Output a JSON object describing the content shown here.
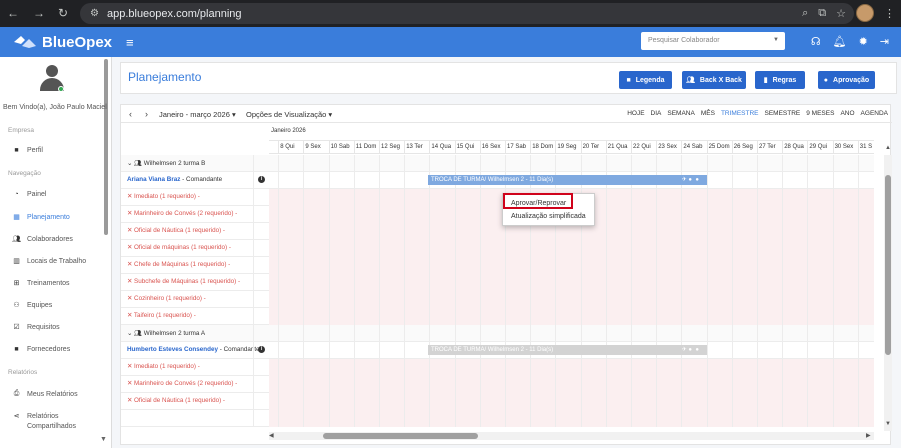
{
  "browser": {
    "url": "app.blueopex.com/planning"
  },
  "topbar": {
    "brand": "BlueOpex",
    "search_placeholder": "Pesquisar Colaborador"
  },
  "sidebar": {
    "welcome": "Bem Vindo(a), João Paulo Maciel",
    "sections": {
      "empresa": "Empresa",
      "navegacao": "Navegação",
      "relatorios": "Relatórios"
    },
    "items": {
      "perfil": "Perfil",
      "painel": "Painel",
      "planejamento": "Planejamento",
      "colaboradores": "Colaboradores",
      "locais": "Locais de Trabalho",
      "treinamentos": "Treinamentos",
      "equipes": "Equipes",
      "requisitos": "Requisitos",
      "fornecedores": "Fornecedores",
      "meus_relatorios": "Meus Relatórios",
      "relatorios_comp": "Relatórios",
      "relatorios_comp2": "Compartilhados"
    }
  },
  "page": {
    "title": "Planejamento",
    "buttons": {
      "legenda": "Legenda",
      "backxback": "Back X Back",
      "regras": "Regras",
      "aprovacao": "Aprovação"
    }
  },
  "calendar": {
    "range": "Janeiro - março 2026",
    "view_options": "Opções de Visualização",
    "views": [
      "HOJE",
      "DIA",
      "SEMANA",
      "MÊS",
      "TRIMESTRE",
      "SEMESTRE",
      "9 MESES",
      "ANO",
      "AGENDA"
    ],
    "active_view": "TRIMESTRE",
    "month": "Janeiro 2026",
    "days": [
      "e",
      "8 Qui",
      "9 Sex",
      "10 Sab",
      "11 Dom",
      "12 Seg",
      "13 Ter",
      "14 Qua",
      "15 Qui",
      "16 Sex",
      "17 Sab",
      "18 Dom",
      "19 Seg",
      "20 Ter",
      "21 Qua",
      "22 Qui",
      "23 Sex",
      "24 Sab",
      "25 Dom",
      "26 Seg",
      "27 Ter",
      "28 Qua",
      "29 Qui",
      "30 Sex",
      "31 S"
    ]
  },
  "rows": {
    "g1": "Wilhelmsen 2 turma B",
    "p1_name": "Ariana Viana Braz",
    "p1_role": " - Comandante",
    "r1": "✕ Imediato (1 requerido) -",
    "r2": "✕ Marinheiro de Convés (2 requerido) -",
    "r3": "✕ Oficial de Náutica (1 requerido) -",
    "r4": "✕ Oficial de máquinas (1 requerido) -",
    "r5": "✕ Chefe de Máquinas (1 requerido) -",
    "r6": "✕ Subchefe de Máquinas (1 requerido) -",
    "r7": "✕ Cozinheiro (1 requerido) -",
    "r8": "✕ Taifeiro (1 requerido) -",
    "g2": "Wilhelmsen 2 turma A",
    "p2_name": "Humberto Esteves Consendey",
    "p2_role": " - Comandante",
    "r9": "✕ Imediato (1 requerido) -",
    "r10": "✕ Marinheiro de Convés (2 requerido) -",
    "r11": "✕ Oficial de Náutica (1 requerido) -"
  },
  "bars": {
    "bar1": "TROCA DE TURMA/ Wilhelmsen 2 - 11 Dia(s)",
    "bar2": "TROCA DE TURMA/ Wilhelmsen 2 - 11 Dia(s)"
  },
  "context_menu": {
    "approve": "Aprovar/Reprovar",
    "simplified": "Atualização simplificada"
  }
}
